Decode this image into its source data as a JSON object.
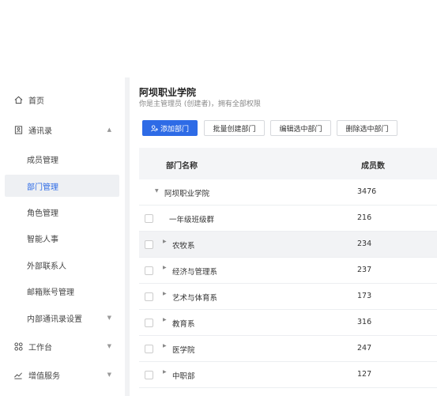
{
  "sidebar": {
    "items": [
      {
        "label": "首页",
        "icon": "home-icon"
      },
      {
        "label": "通讯录",
        "icon": "contacts-icon",
        "arrow": "▲"
      },
      {
        "label": "成员管理"
      },
      {
        "label": "部门管理"
      },
      {
        "label": "角色管理"
      },
      {
        "label": "智能人事"
      },
      {
        "label": "外部联系人"
      },
      {
        "label": "邮箱账号管理"
      },
      {
        "label": "内部通讯录设置",
        "arrow": "▼"
      },
      {
        "label": "工作台",
        "icon": "workbench-icon",
        "arrow": "▼"
      },
      {
        "label": "增值服务",
        "icon": "chart-icon",
        "arrow": "▼"
      }
    ]
  },
  "header": {
    "title": "阿坝职业学院",
    "subtitle": "你是主管理员 (创建者)，拥有全部权限"
  },
  "toolbar": {
    "add": "添加部门",
    "batch_create": "批量创建部门",
    "edit_selected": "编辑选中部门",
    "delete_selected": "删除选中部门"
  },
  "table": {
    "headers": {
      "name": "部门名称",
      "count": "成员数"
    },
    "rows": [
      {
        "name": "阿坝职业学院",
        "count": "3476"
      },
      {
        "name": "一年级班级群",
        "count": "216"
      },
      {
        "name": "农牧系",
        "count": "234"
      },
      {
        "name": "经济与管理系",
        "count": "237"
      },
      {
        "name": "艺术与体育系",
        "count": "173"
      },
      {
        "name": "教育系",
        "count": "316"
      },
      {
        "name": "医学院",
        "count": "247"
      },
      {
        "name": "中职部",
        "count": "127"
      }
    ]
  },
  "colors": {
    "accent": "#2e6be6",
    "row_highlight": "#f2f3f5"
  }
}
